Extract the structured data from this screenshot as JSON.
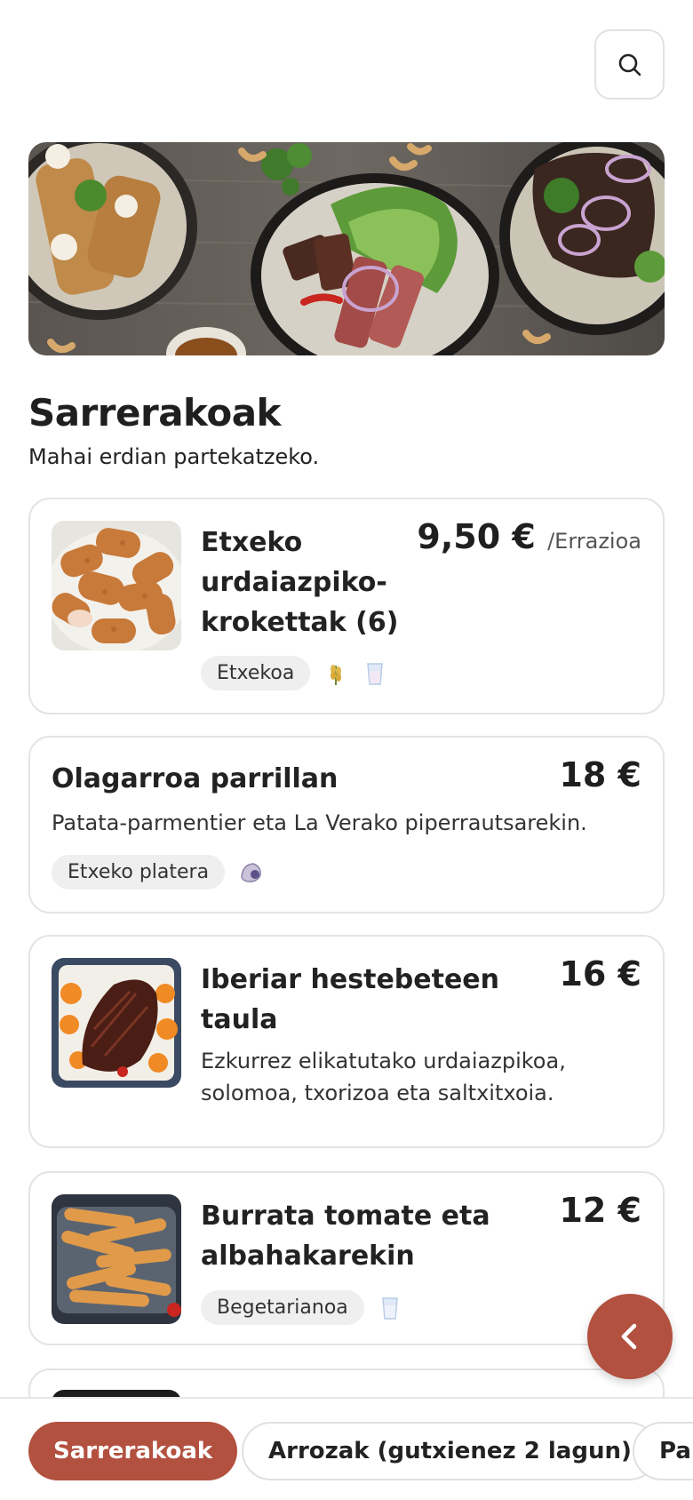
{
  "header": {
    "search_icon": "search-icon"
  },
  "section": {
    "title": "Sarrerakoak",
    "subtitle": "Mahai erdian partekatzeko."
  },
  "items": [
    {
      "name": "Etxeko urdaiazpiko-krokettak (6)",
      "price": "9,50 €",
      "unit": "/Errazioa",
      "tag": "Etxekoa",
      "allergens": [
        "gluten-wheat-icon",
        "milk-glass-icon"
      ]
    },
    {
      "name": "Olagarroa parrillan",
      "price": "18 €",
      "description": "Patata-parmentier eta La Verako piperrautsarekin.",
      "tag": "Etxeko platera",
      "allergens": [
        "mollusc-shell-icon"
      ]
    },
    {
      "name": "Iberiar hestebeteen taula",
      "price": "16 €",
      "description": "Ezkurrez elikatutako urdaiazpikoa, solomoa, txorizoa eta saltxitxoia."
    },
    {
      "name": "Burrata tomate eta albahakarekin",
      "price": "12 €",
      "tag": "Begetarianoa",
      "allergens": [
        "milk-glass-icon"
      ]
    }
  ],
  "fab": {
    "icon": "chevron-left-icon"
  },
  "categories": [
    {
      "label": "Sarrerakoak",
      "active": true
    },
    {
      "label": "Arrozak (gutxienez 2 lagun)",
      "active": false
    },
    {
      "label": "Par",
      "active": false
    }
  ],
  "colors": {
    "accent": "#b2513f",
    "border": "#e4e4e4",
    "tag_bg": "#efefef"
  }
}
